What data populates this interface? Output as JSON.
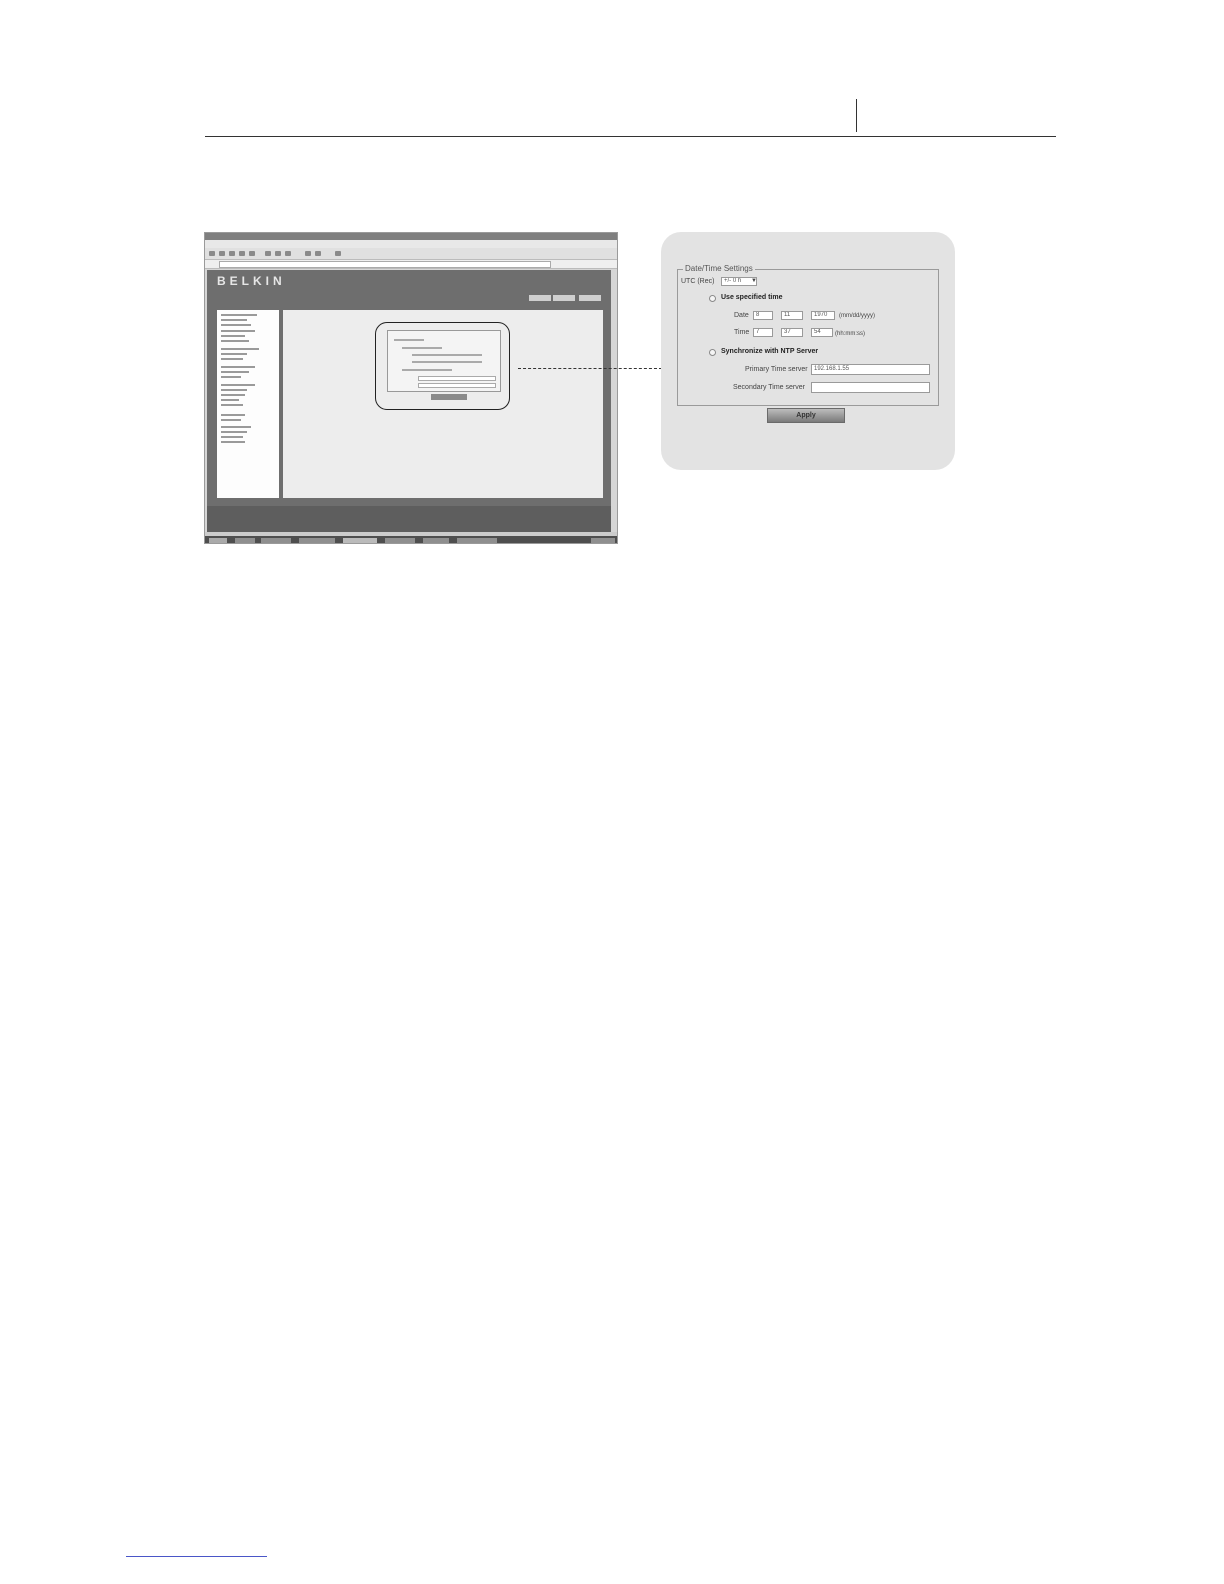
{
  "shot": {
    "brand": "BELKIN"
  },
  "panel": {
    "legend": "Date/Time Settings",
    "utc_label": "UTC (Rec)",
    "utc_value": "+/- 0 h",
    "specified_label": "Use specified time",
    "date_label": "Date",
    "date_mm": "8",
    "date_dd": "11",
    "date_yyyy": "1970",
    "date_format": "(mm/dd/yyyy)",
    "time_label": "Time",
    "time_hh": "7",
    "time_mm": "37",
    "time_ss": "54",
    "time_format": "(hh:mm:ss)",
    "ntp_label": "Synchronize with NTP Server",
    "primary_label": "Primary Time server",
    "primary_value": "192.168.1.55",
    "secondary_label": "Secondary Time server",
    "secondary_value": "",
    "apply_label": "Apply"
  }
}
